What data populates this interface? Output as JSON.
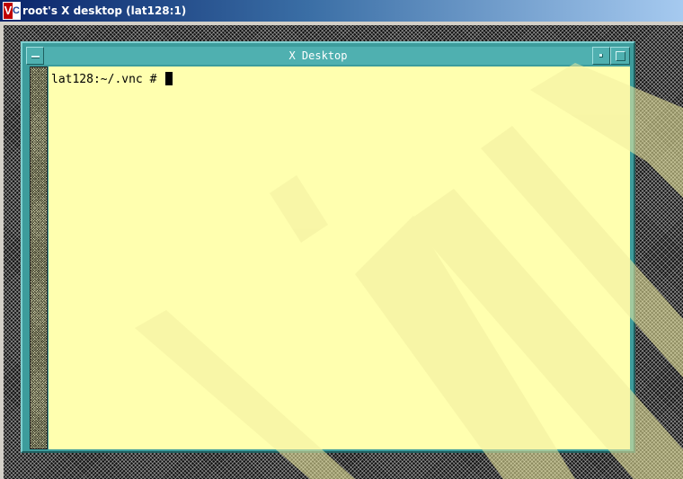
{
  "viewer": {
    "logo_letters": [
      "V",
      "C"
    ],
    "title": "root's X desktop (lat128:1)"
  },
  "xterm": {
    "title": "X Desktop",
    "prompt": "lat128:~/.vnc # "
  },
  "colors": {
    "desktop": "#111111",
    "window_frame": "#3d9c9c",
    "terminal_bg": "#ffffaf",
    "watermark": "#f2eea0"
  },
  "icons": [
    "window-menu-icon",
    "minimize-icon",
    "maximize-icon",
    "vnc-logo-icon"
  ]
}
